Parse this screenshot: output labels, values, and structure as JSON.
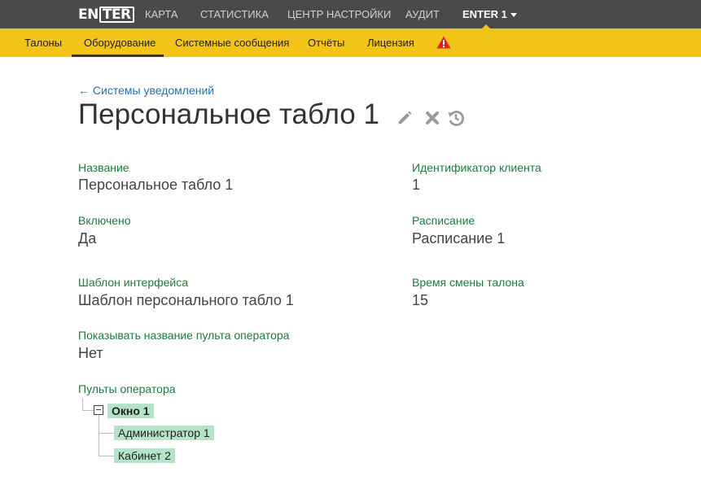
{
  "topnav": {
    "logo_left": "EN",
    "logo_boxed": "TER",
    "items": [
      "КАРТА",
      "СТАТИСТИКА",
      "ЦЕНТР НАСТРОЙКИ",
      "АУДИТ"
    ],
    "user_menu": "ENTER 1"
  },
  "subnav": {
    "items": [
      "Талоны",
      "Оборудование",
      "Системные сообщения",
      "Отчёты",
      "Лицензия"
    ],
    "active": "Оборудование",
    "warning_icon": "warning-triangle-icon",
    "warning_color": "#e02020"
  },
  "breadcrumb": {
    "back": "← Системы уведомлений"
  },
  "title": "Персональное табло 1",
  "actions": [
    "pencil-icon",
    "close-icon",
    "history-icon"
  ],
  "fields": {
    "name": {
      "label": "Название",
      "value": "Персональное табло 1"
    },
    "client_id": {
      "label": "Идентификатор клиента",
      "value": "1"
    },
    "enabled": {
      "label": "Включено",
      "value": "Да"
    },
    "schedule": {
      "label": "Расписание",
      "value": "Расписание 1"
    },
    "template": {
      "label": "Шаблон интерфейса",
      "value": "Шаблон персонального табло 1"
    },
    "ticket_time": {
      "label": "Время смены талона",
      "value": "15"
    },
    "show_name": {
      "label": "Показывать название пульта оператора",
      "value": "Нет"
    }
  },
  "operators": {
    "label": "Пульты оператора",
    "root": "Окно 1",
    "children": [
      "Администратор 1",
      "Кабинет 2"
    ]
  },
  "colors": {
    "topbar": "#4a4a4a",
    "subbar": "#f2c418",
    "label_green": "#1e7a3c",
    "link_blue": "#2a6fb0",
    "tree_highlight": "#b6e3c8"
  }
}
